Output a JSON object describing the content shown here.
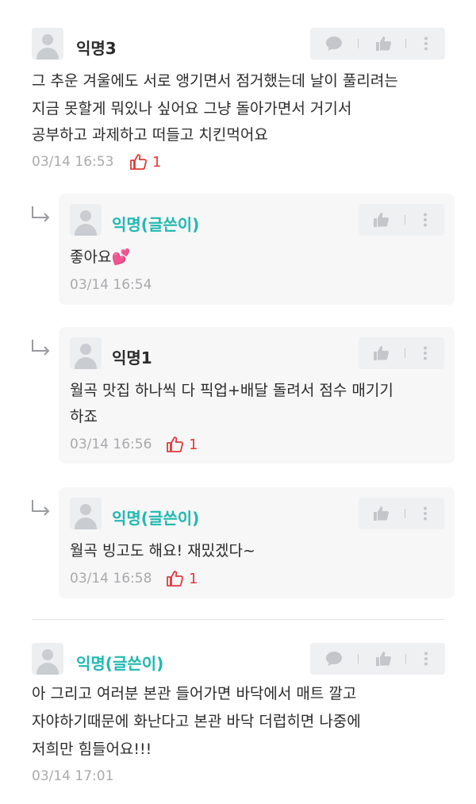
{
  "colors": {
    "op_author": "#1fb9b0",
    "like_red": "#e03a3a",
    "meta_gray": "#a9aaac"
  },
  "icons": {
    "avatar": "default-user-icon",
    "comment": "speech-bubble-icon",
    "like": "thumbs-up-icon",
    "more": "vertical-dots-icon",
    "reply": "reply-arrow-icon"
  },
  "comments": [
    {
      "author": "익명3",
      "lines": [
        "그 추운 겨울에도 서로 앵기면서 점거했는데 날이 풀리려는",
        "지금 못할게 뭐있나 싶어요 그냥 돌아가면서 거기서",
        "공부하고 과제하고 떠들고 치킨먹어요"
      ],
      "time": "03/14 16:53",
      "likes": "1"
    },
    {
      "author": "익명(글쓴이)",
      "lines": [
        "좋아요💕"
      ],
      "time": "03/14 16:54",
      "likes": ""
    },
    {
      "author": "익명1",
      "lines": [
        "월곡 맛집 하나씩 다 픽업+배달 돌려서 점수 매기기",
        "하죠"
      ],
      "time": "03/14 16:56",
      "likes": "1"
    },
    {
      "author": "익명(글쓴이)",
      "lines": [
        "월곡 빙고도 해요! 재밌겠다~"
      ],
      "time": "03/14 16:58",
      "likes": "1"
    },
    {
      "author": "익명(글쓴이)",
      "lines": [
        "아 그리고 여러분 본관 들어가면 바닥에서 매트 깔고",
        "자야하기때문에 화난다고 본관 바닥 더럽히면 나중에",
        "저희만 힘들어요!!!"
      ],
      "time": "03/14 17:01",
      "likes": ""
    }
  ]
}
